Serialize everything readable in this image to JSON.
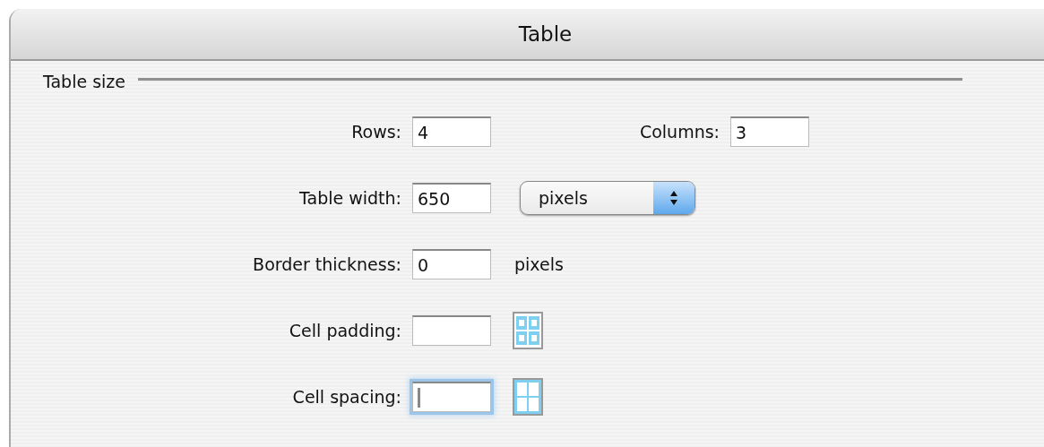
{
  "window": {
    "title": "Table"
  },
  "section": {
    "title": "Table size"
  },
  "rows": [
    {
      "kind": "pair",
      "label": "Rows:",
      "value": "4",
      "focused": false,
      "label2": "Columns:",
      "value2": "3"
    },
    {
      "kind": "select",
      "label": "Table width:",
      "value": "650",
      "focused": false,
      "option": "pixels"
    },
    {
      "kind": "unit",
      "label": "Border thickness:",
      "value": "0",
      "focused": false,
      "unit": "pixels"
    },
    {
      "kind": "padding",
      "label": "Cell padding:",
      "focused": false
    },
    {
      "kind": "spacing",
      "label": "Cell spacing:",
      "focused": true
    }
  ]
}
